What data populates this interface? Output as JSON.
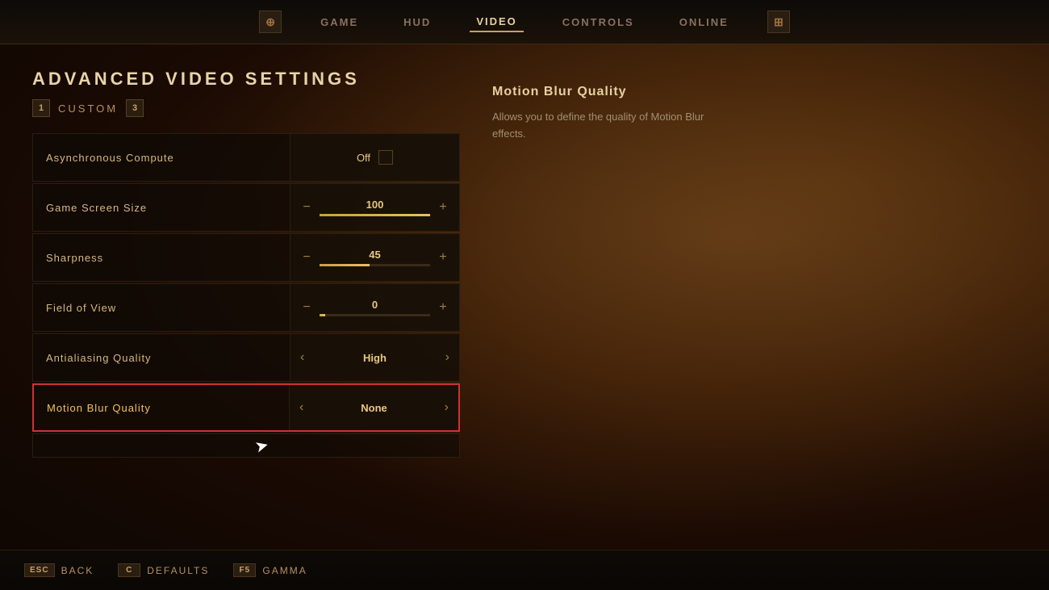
{
  "topbar": {
    "icon_left": "🎯",
    "icon_right": "🔰",
    "nav_items": [
      {
        "label": "GAME",
        "active": false
      },
      {
        "label": "HUD",
        "active": false
      },
      {
        "label": "VIDEO",
        "active": true
      },
      {
        "label": "CONTROLS",
        "active": false
      },
      {
        "label": "ONLINE",
        "active": false
      }
    ]
  },
  "page": {
    "title": "ADVANCED VIDEO SETTINGS",
    "preset_num1": "1",
    "preset_label": "CUSTOM",
    "preset_num2": "3"
  },
  "settings": [
    {
      "name": "Asynchronous Compute",
      "type": "toggle",
      "value": "Off",
      "checked": false
    },
    {
      "name": "Game Screen Size",
      "type": "slider",
      "value": "100",
      "fill_pct": 100
    },
    {
      "name": "Sharpness",
      "type": "slider",
      "value": "45",
      "fill_pct": 45
    },
    {
      "name": "Field of View",
      "type": "slider",
      "value": "0",
      "fill_pct": 5
    },
    {
      "name": "Antialiasing Quality",
      "type": "dropdown",
      "value": "High"
    },
    {
      "name": "Motion Blur Quality",
      "type": "dropdown",
      "value": "None",
      "selected": true
    }
  ],
  "info_panel": {
    "title": "Motion Blur Quality",
    "description": "Allows you to define the quality of Motion Blur effects."
  },
  "bottom_bar": {
    "actions": [
      {
        "key": "ESC",
        "label": "Back"
      },
      {
        "key": "C",
        "label": "Defaults"
      },
      {
        "key": "F5",
        "label": "Gamma"
      }
    ]
  }
}
